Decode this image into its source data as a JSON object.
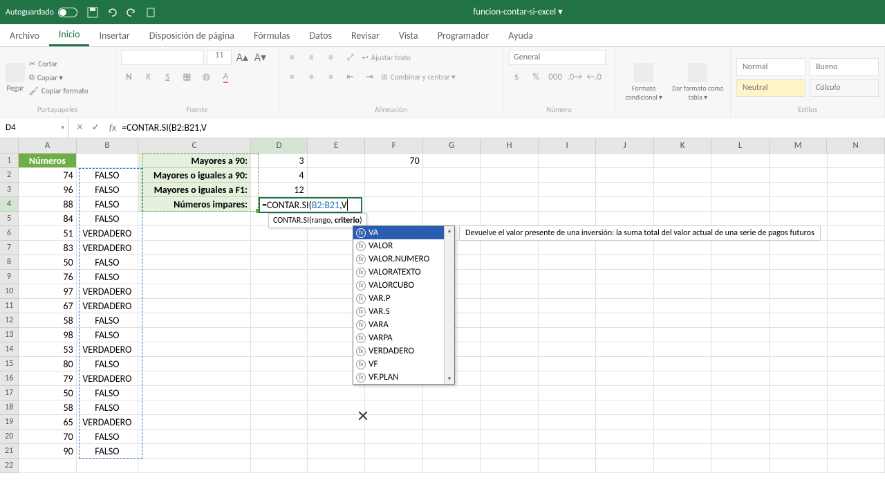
{
  "title": {
    "autosave": "Autoguardado",
    "filename": "funcion-contar-si-excel ▾"
  },
  "tabs": [
    "Archivo",
    "Inicio",
    "Insertar",
    "Disposición de página",
    "Fórmulas",
    "Datos",
    "Revisar",
    "Vista",
    "Programador",
    "Ayuda"
  ],
  "ribbon": {
    "paste": "Pegar",
    "cut": "Cortar",
    "copy": "Copiar ▾",
    "fmtpaint": "Copiar formato",
    "clipboard": "Portapapeles",
    "font": "Fuente",
    "fontsize": "11",
    "align": "Alineación",
    "wrap": "Ajustar texto",
    "merge": "Combinar y centrar ▾",
    "number": "Número",
    "numfmt": "General",
    "condfmt": "Formato condicional ▾",
    "table": "Dar formato como tabla ▾",
    "styles": "Estilos",
    "s_normal": "Normal",
    "s_good": "Bueno",
    "s_neutral": "Neutral",
    "s_calc": "Cálculo"
  },
  "fbar": {
    "name": "D4",
    "formula": "=CONTAR.SI(B2:B21,V"
  },
  "cols": [
    "A",
    "B",
    "C",
    "D",
    "E",
    "F",
    "G",
    "H",
    "I",
    "J",
    "K",
    "L",
    "M",
    "N"
  ],
  "sheet": {
    "header": "Números",
    "A": [
      74,
      96,
      88,
      84,
      51,
      83,
      50,
      76,
      97,
      67,
      58,
      98,
      53,
      80,
      79,
      50,
      58,
      65,
      70,
      90
    ],
    "B": [
      "FALSO",
      "FALSO",
      "FALSO",
      "FALSO",
      "VERDADERO",
      "VERDADERO",
      "FALSO",
      "FALSO",
      "VERDADERO",
      "VERDADERO",
      "FALSO",
      "FALSO",
      "VERDADERO",
      "FALSO",
      "VERDADERO",
      "FALSO",
      "FALSO",
      "VERDADERO",
      "FALSO",
      "FALSO"
    ],
    "C": [
      "Mayores a 90:",
      "Mayores o iguales a 90:",
      "Mayores o iguales a F1:",
      "Números impares:"
    ],
    "D": [
      3,
      4,
      12
    ],
    "F1": 70
  },
  "editing": {
    "prefix": "=CONTAR.SI(",
    "ref": "B2:B21",
    "suffix": ",V"
  },
  "functip": {
    "fn": "CONTAR.SI(",
    "arg1": "rango",
    "sep": ", ",
    "arg2": "criterio",
    "close": ")"
  },
  "autolist": [
    "VA",
    "VALOR",
    "VALOR.NUMERO",
    "VALORATEXTO",
    "VALORCUBO",
    "VAR.P",
    "VAR.S",
    "VARA",
    "VARPA",
    "VERDADERO",
    "VF",
    "VF.PLAN"
  ],
  "desc": "Devuelve el valor presente de una inversión: la suma total del valor actual de una serie de pagos futuros"
}
